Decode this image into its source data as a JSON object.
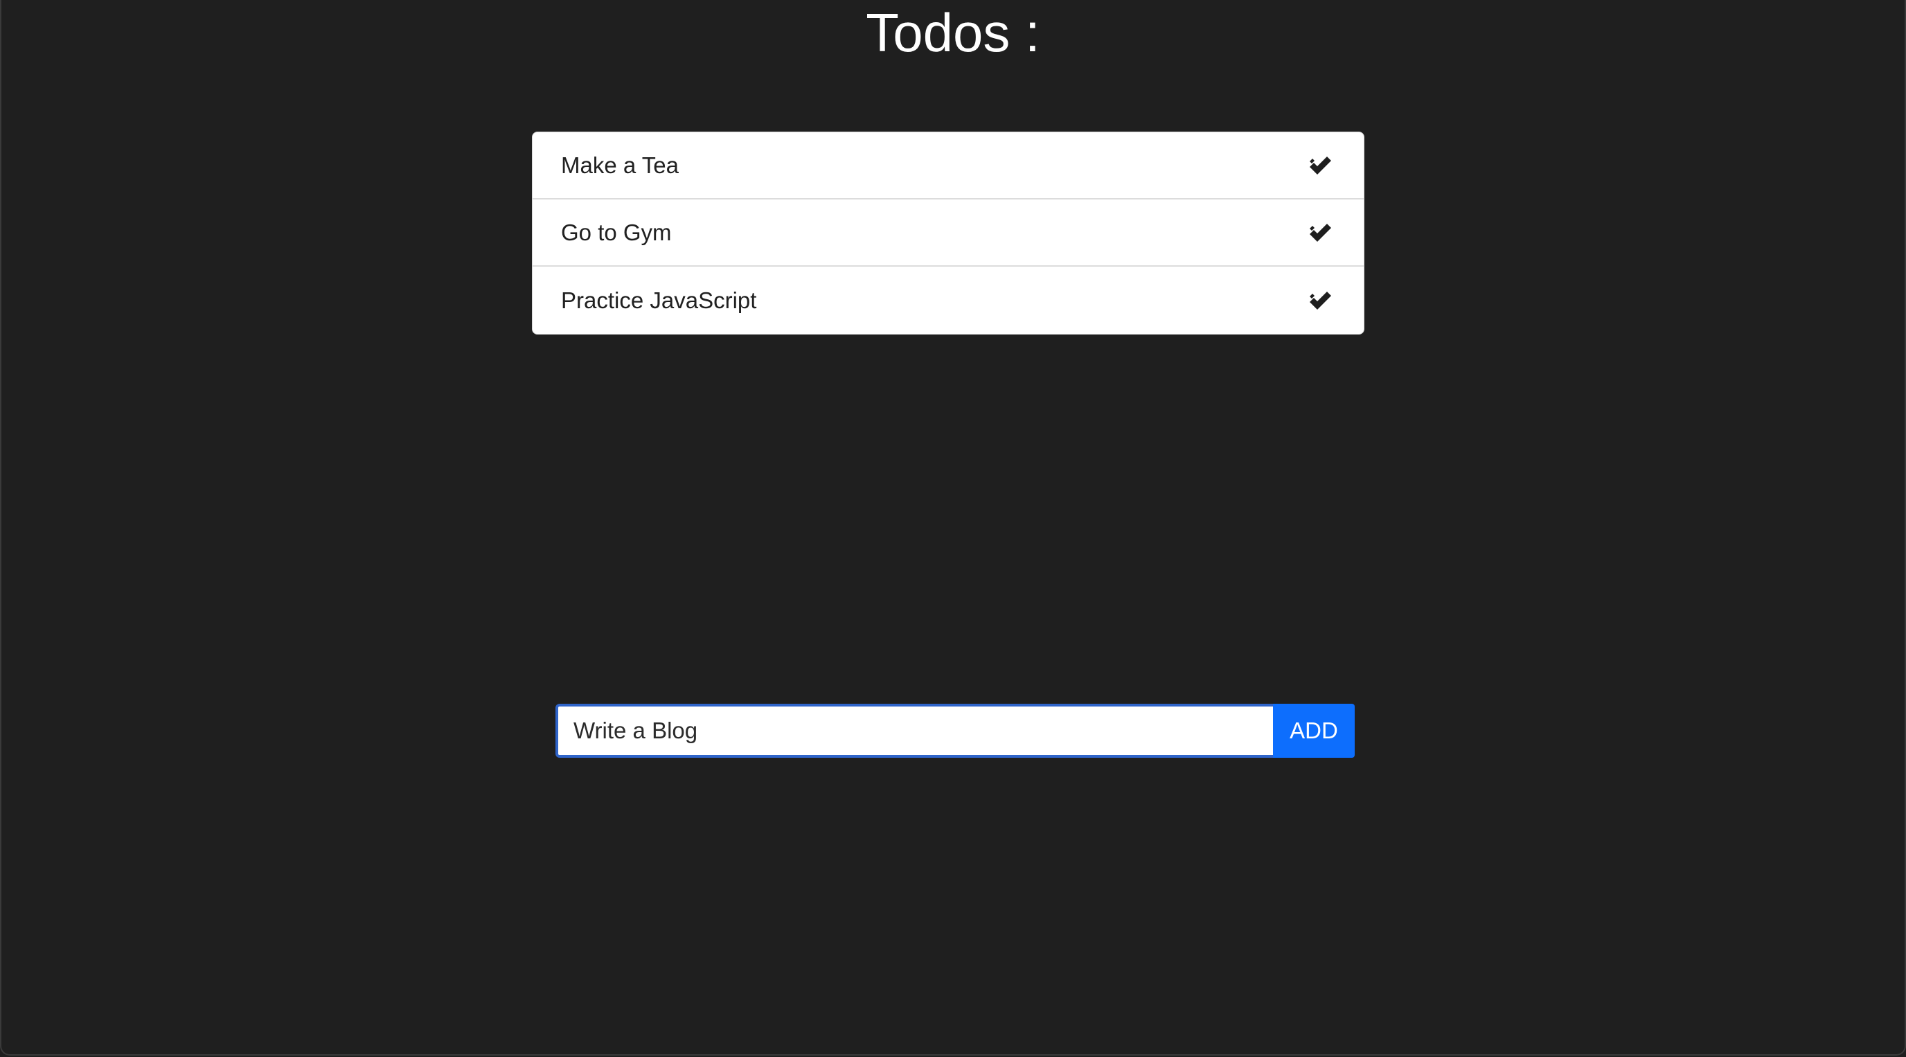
{
  "page": {
    "title": "Todos :"
  },
  "todos": [
    {
      "text": "Make a Tea",
      "icon": "double-check-icon"
    },
    {
      "text": "Go to Gym",
      "icon": "double-check-icon"
    },
    {
      "text": "Practice JavaScript",
      "icon": "double-check-icon"
    }
  ],
  "form": {
    "input_value": "Write a Blog",
    "add_label": "ADD"
  },
  "colors": {
    "background": "#1f1f1f",
    "accent": "#0d6efd",
    "input_focus_border": "#2f64c9"
  }
}
